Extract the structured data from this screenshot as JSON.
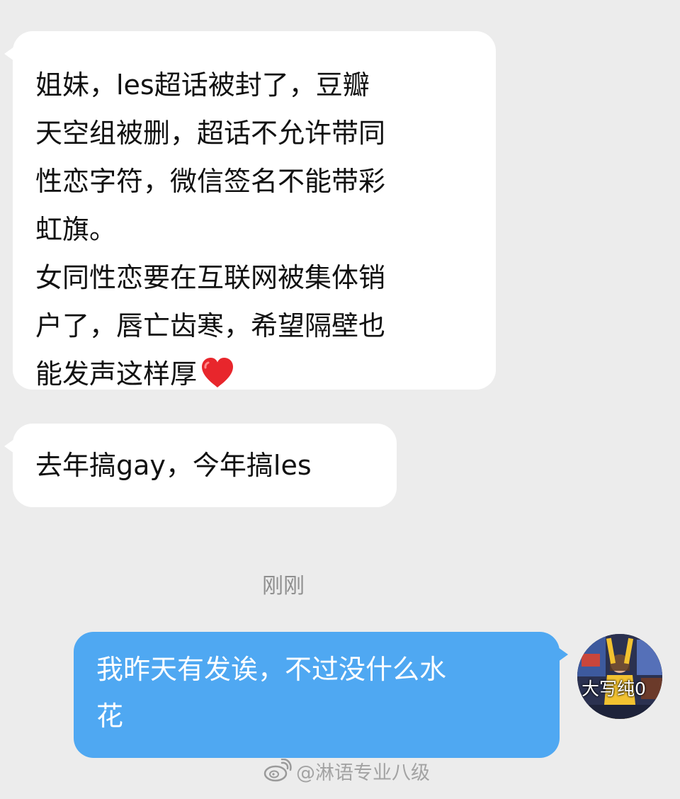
{
  "messages": [
    {
      "side": "left",
      "text": "姐妹，les超话被封了，豆瓣\n天空组被删，超话不允许带同\n性恋字符，微信签名不能带彩\n虹旗。\n女同性恋要在互联网被集体销\n户了，唇亡齿寒，希望隔壁也\n能发声这样厚",
      "emoji": "red-heart"
    },
    {
      "side": "left",
      "text": "去年搞gay，今年搞les"
    },
    {
      "side": "right",
      "text": "我昨天有发诶，不过没什么水\n花"
    }
  ],
  "timestamp": "刚刚",
  "avatar": {
    "label": "大写纯0"
  },
  "watermark": {
    "icon": "weibo-icon",
    "text": "@淋语专业八级"
  },
  "colors": {
    "background": "#ececec",
    "incoming_bubble": "#ffffff",
    "outgoing_bubble": "#4fa8f2",
    "timestamp": "#8f8f8f",
    "heart": "#e8262c"
  }
}
